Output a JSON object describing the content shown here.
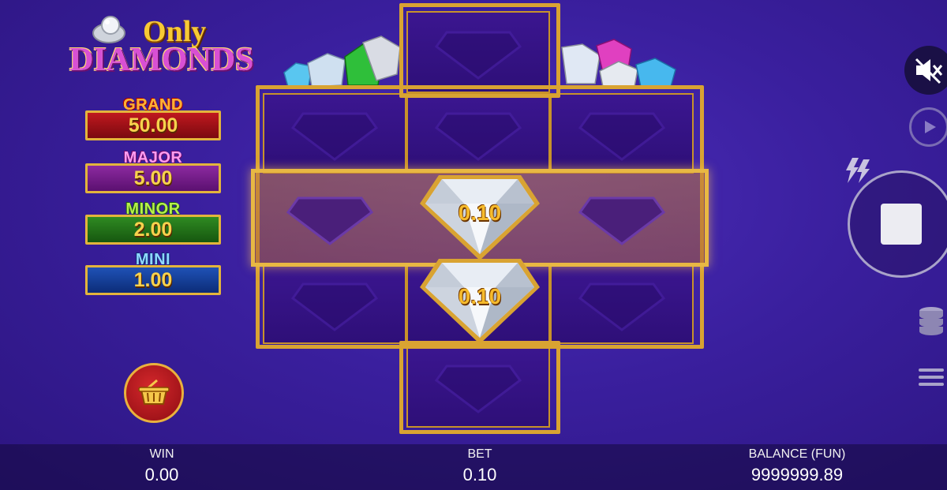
{
  "logo": {
    "line1": "Only",
    "line2": "DIAMONDS"
  },
  "jackpots": [
    {
      "name": "GRAND",
      "value": "50.00"
    },
    {
      "name": "MAJOR",
      "value": "5.00"
    },
    {
      "name": "MINOR",
      "value": "2.00"
    },
    {
      "name": "MINI",
      "value": "1.00"
    }
  ],
  "reels": {
    "symbols": [
      {
        "type": "diamond",
        "value": "0.10"
      },
      {
        "type": "diamond",
        "value": "0.10"
      }
    ]
  },
  "footer": {
    "win_label": "WIN",
    "win_value": "0.00",
    "bet_label": "BET",
    "bet_value": "0.10",
    "balance_label": "BALANCE (FUN)",
    "balance_value": "9999999.89"
  },
  "icons": {
    "mute": "speaker-muted-icon",
    "autoplay": "autoplay-icon",
    "turbo": "lightning-icon",
    "spin": "stop-icon",
    "bet": "coin-stack-icon",
    "menu": "hamburger-menu-icon",
    "buy": "basket-icon"
  },
  "colors": {
    "accent_gold": "#d9a332",
    "background": "#3a1f9e"
  }
}
